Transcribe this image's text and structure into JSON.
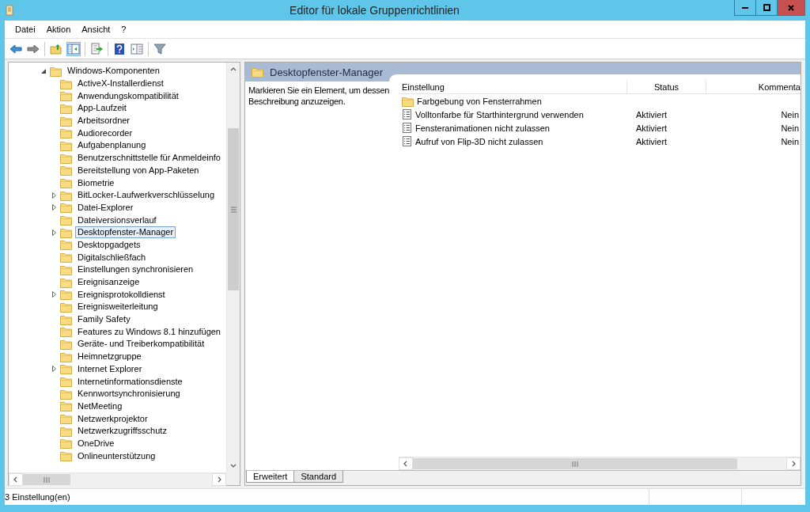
{
  "window": {
    "title": "Editor für lokale Gruppenrichtlinien"
  },
  "menu": [
    "Datei",
    "Aktion",
    "Ansicht",
    "?"
  ],
  "tree": {
    "label": "Windows-Komponenten",
    "expanded": true,
    "children": [
      {
        "label": "ActiveX-Installerdienst",
        "expandable": false,
        "selected": false
      },
      {
        "label": "Anwendungskompatibilität",
        "expandable": false,
        "selected": false
      },
      {
        "label": "App-Laufzeit",
        "expandable": false,
        "selected": false
      },
      {
        "label": "Arbeitsordner",
        "expandable": false,
        "selected": false
      },
      {
        "label": "Audiorecorder",
        "expandable": false,
        "selected": false
      },
      {
        "label": "Aufgabenplanung",
        "expandable": false,
        "selected": false
      },
      {
        "label": "Benutzerschnittstelle für Anmeldeinfo",
        "expandable": false,
        "selected": false
      },
      {
        "label": "Bereitstellung von App-Paketen",
        "expandable": false,
        "selected": false
      },
      {
        "label": "Biometrie",
        "expandable": false,
        "selected": false
      },
      {
        "label": "BitLocker-Laufwerkverschlüsselung",
        "expandable": true,
        "selected": false
      },
      {
        "label": "Datei-Explorer",
        "expandable": true,
        "selected": false
      },
      {
        "label": "Dateiversionsverlauf",
        "expandable": false,
        "selected": false
      },
      {
        "label": "Desktopfenster-Manager",
        "expandable": true,
        "selected": true
      },
      {
        "label": "Desktopgadgets",
        "expandable": false,
        "selected": false
      },
      {
        "label": "Digitalschließfach",
        "expandable": false,
        "selected": false
      },
      {
        "label": "Einstellungen synchronisieren",
        "expandable": false,
        "selected": false
      },
      {
        "label": "Ereignisanzeige",
        "expandable": false,
        "selected": false
      },
      {
        "label": "Ereignisprotokolldienst",
        "expandable": true,
        "selected": false
      },
      {
        "label": "Ereignisweiterleitung",
        "expandable": false,
        "selected": false
      },
      {
        "label": "Family Safety",
        "expandable": false,
        "selected": false
      },
      {
        "label": "Features zu Windows 8.1 hinzufügen",
        "expandable": false,
        "selected": false
      },
      {
        "label": "Geräte- und Treiberkompatibilität",
        "expandable": false,
        "selected": false
      },
      {
        "label": "Heimnetzgruppe",
        "expandable": false,
        "selected": false
      },
      {
        "label": "Internet Explorer",
        "expandable": true,
        "selected": false
      },
      {
        "label": "Internetinformationsdienste",
        "expandable": false,
        "selected": false
      },
      {
        "label": "Kennwortsynchronisierung",
        "expandable": false,
        "selected": false
      },
      {
        "label": "NetMeeting",
        "expandable": false,
        "selected": false
      },
      {
        "label": "Netzwerkprojektor",
        "expandable": false,
        "selected": false
      },
      {
        "label": "Netzwerkzugriffsschutz",
        "expandable": false,
        "selected": false
      },
      {
        "label": "OneDrive",
        "expandable": false,
        "selected": false
      },
      {
        "label": "Onlineunterstützung",
        "expandable": false,
        "selected": false
      }
    ]
  },
  "detail": {
    "title": "Desktopfenster-Manager",
    "description": "Markieren Sie ein Element, um dessen Beschreibung anzuzeigen.",
    "columns": [
      "Einstellung",
      "Status",
      "Kommenta"
    ],
    "rows": [
      {
        "kind": "folder",
        "name": "Farbgebung von Fensterrahmen"
      },
      {
        "kind": "setting",
        "name": "Volltonfarbe für Starthintergrund verwenden",
        "status": "Aktiviert",
        "comment": "Nein"
      },
      {
        "kind": "setting",
        "name": "Fensteranimationen nicht zulassen",
        "status": "Aktiviert",
        "comment": "Nein"
      },
      {
        "kind": "setting",
        "name": "Aufruf von Flip-3D nicht zulassen",
        "status": "Aktiviert",
        "comment": "Nein"
      }
    ]
  },
  "view_tabs": [
    {
      "label": "Erweitert",
      "selected": true
    },
    {
      "label": "Standard",
      "selected": false
    }
  ],
  "status_bar": {
    "text": "3 Einstellung(en)"
  }
}
